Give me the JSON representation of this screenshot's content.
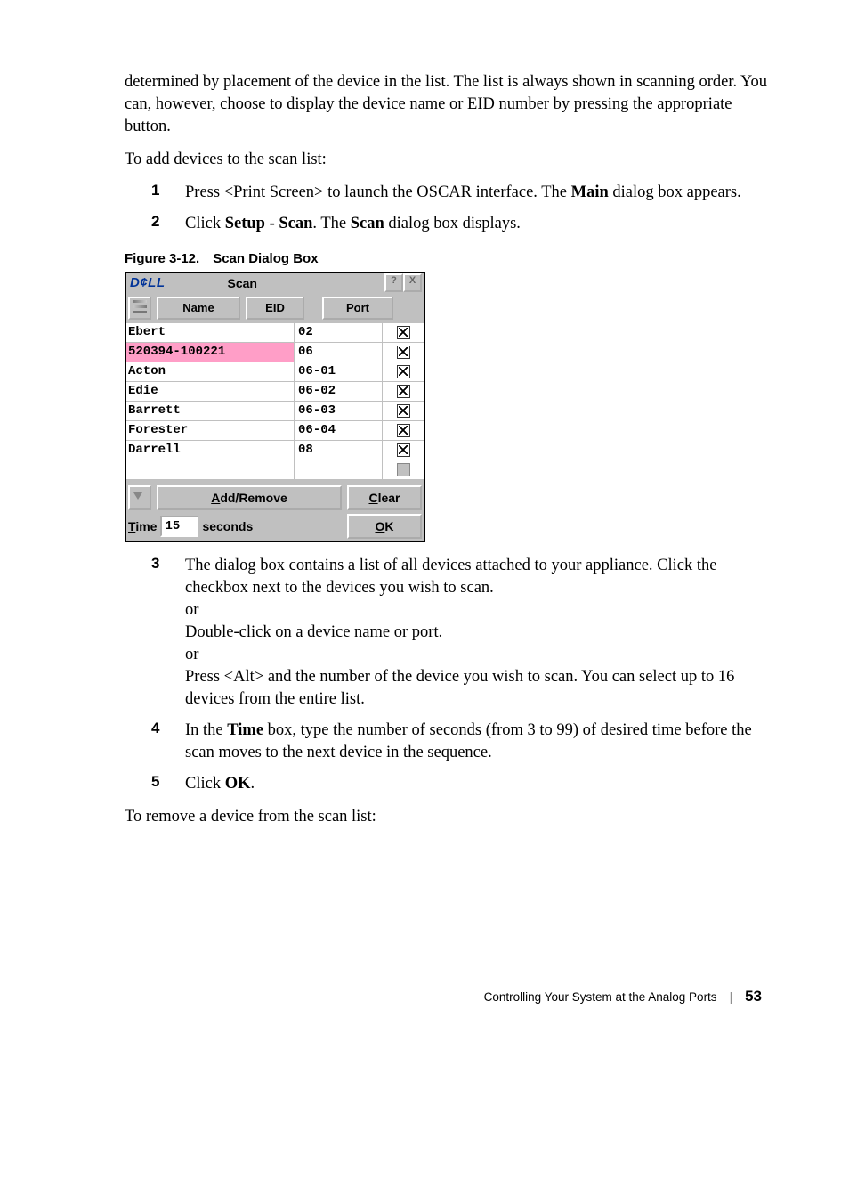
{
  "para1": "determined by placement of the device in the list. The list is always shown in scanning order. You can, however, choose to display the device name or EID number by pressing the appropriate button.",
  "para2": "To add devices to the scan list:",
  "steps_a": {
    "n1": "1",
    "t1_a": "Press <Print Screen> to launch the OSCAR interface. The ",
    "t1_b": "Main",
    "t1_c": " dialog box appears.",
    "n2": "2",
    "t2_a": "Click ",
    "t2_b": "Setup - Scan",
    "t2_c": ". The ",
    "t2_d": "Scan",
    "t2_e": " dialog box displays."
  },
  "figcap": "Figure 3-12. Scan Dialog Box",
  "dialog": {
    "logo": "D¢LL",
    "title": "Scan",
    "help": "?",
    "close": "X",
    "col_name": "ame",
    "col_name_u": "N",
    "col_eid": "ID",
    "col_eid_u": "E",
    "col_port": "ort",
    "col_port_u": "P",
    "rows": [
      {
        "name": "Ebert",
        "port": "02",
        "checked": true
      },
      {
        "name": "520394-100221",
        "port": "06",
        "checked": true,
        "selected": true
      },
      {
        "name": "Acton",
        "port": "06-01",
        "checked": true
      },
      {
        "name": "Edie",
        "port": "06-02",
        "checked": true
      },
      {
        "name": "Barrett",
        "port": "06-03",
        "checked": true
      },
      {
        "name": "Forester",
        "port": "06-04",
        "checked": true
      },
      {
        "name": "Darrell",
        "port": "08",
        "checked": true
      },
      {
        "name": "",
        "port": "",
        "checked": false,
        "disabled": true
      }
    ],
    "addremove_u": "A",
    "addremove": "dd/Remove",
    "clear_u": "C",
    "clear": "lear",
    "time_u": "T",
    "time": "ime",
    "time_val": "15",
    "seconds": "seconds",
    "ok_u": "O",
    "ok": "K"
  },
  "steps_b": {
    "n3": "3",
    "t3a": "The dialog box contains a list of all devices attached to your appliance. Click the checkbox next to the devices you wish to scan.",
    "t3b": "or",
    "t3c": "Double-click on a device name or port.",
    "t3d": "or",
    "t3e": "Press <Alt> and the number of the device you wish to scan. You can select up to 16 devices from the entire list.",
    "n4": "4",
    "t4a": "In the ",
    "t4b": "Time",
    "t4c": " box, type the number of seconds (from 3 to 99) of desired time before the scan moves to the next device in the sequence.",
    "n5": "5",
    "t5a": "Click ",
    "t5b": "OK",
    "t5c": "."
  },
  "para3": "To remove a device from the scan list:",
  "footer": {
    "text": "Controlling Your System at the Analog Ports",
    "page": "53"
  },
  "chart_data": {
    "type": "table",
    "title": "Scan Dialog Box device list",
    "columns": [
      "Name",
      "Port",
      "Checked"
    ],
    "rows": [
      [
        "Ebert",
        "02",
        true
      ],
      [
        "520394-100221",
        "06",
        true
      ],
      [
        "Acton",
        "06-01",
        true
      ],
      [
        "Edie",
        "06-02",
        true
      ],
      [
        "Barrett",
        "06-03",
        true
      ],
      [
        "Forester",
        "06-04",
        true
      ],
      [
        "Darrell",
        "08",
        true
      ]
    ],
    "time_seconds": 15
  }
}
